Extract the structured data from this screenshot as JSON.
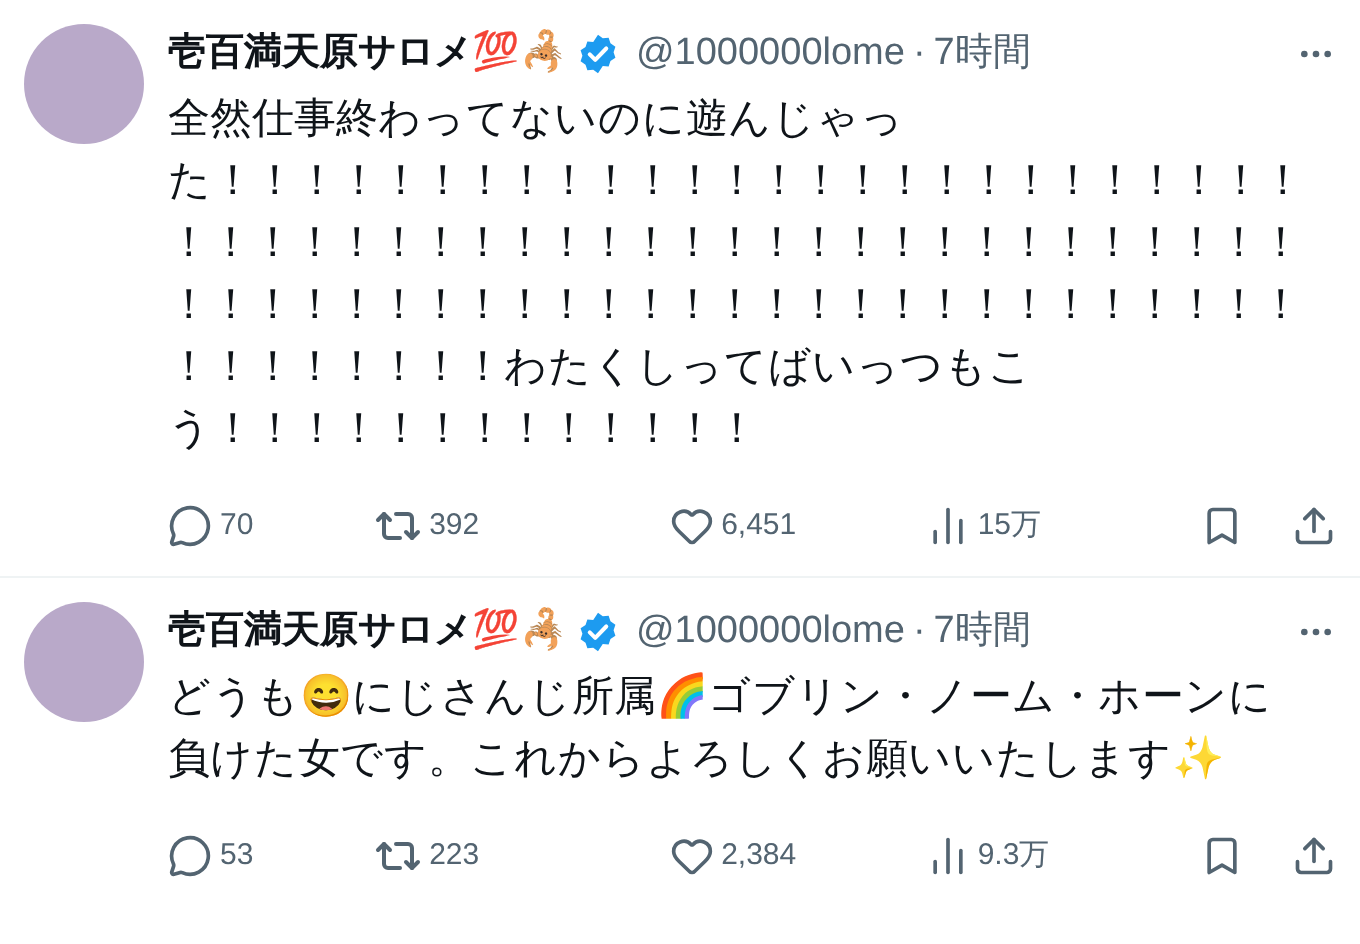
{
  "tweets": [
    {
      "author": {
        "name": "壱百満天原サロメ💯🦂",
        "handle": "@1000000lome",
        "separator": "·",
        "time": "7時間"
      },
      "lines": [
        "全然仕事終わってないのに遊んじゃっ",
        "た！！！！！！！！！！！！！！！！！！！！！！！！！！",
        "！！！！！！！！！！！！！！！！！！！！！！！！！！！",
        "！！！！！！！！！！！！！！！！！！！！！！！！！！！",
        "！！！！！！！！わたくしってばいっつもこ",
        "う！！！！！！！！！！！！！"
      ],
      "stats": {
        "replies": "70",
        "reposts": "392",
        "likes": "6,451",
        "views": "15万"
      }
    },
    {
      "author": {
        "name": "壱百満天原サロメ💯🦂",
        "handle": "@1000000lome",
        "separator": "·",
        "time": "7時間"
      },
      "lines": [
        "どうも😄にじさんじ所属🌈ゴブリン・ノーム・ホーンに",
        "負けた女です。これからよろしくお願いいたします✨"
      ],
      "stats": {
        "replies": "53",
        "reposts": "223",
        "likes": "2,384",
        "views": "9.3万"
      }
    }
  ]
}
